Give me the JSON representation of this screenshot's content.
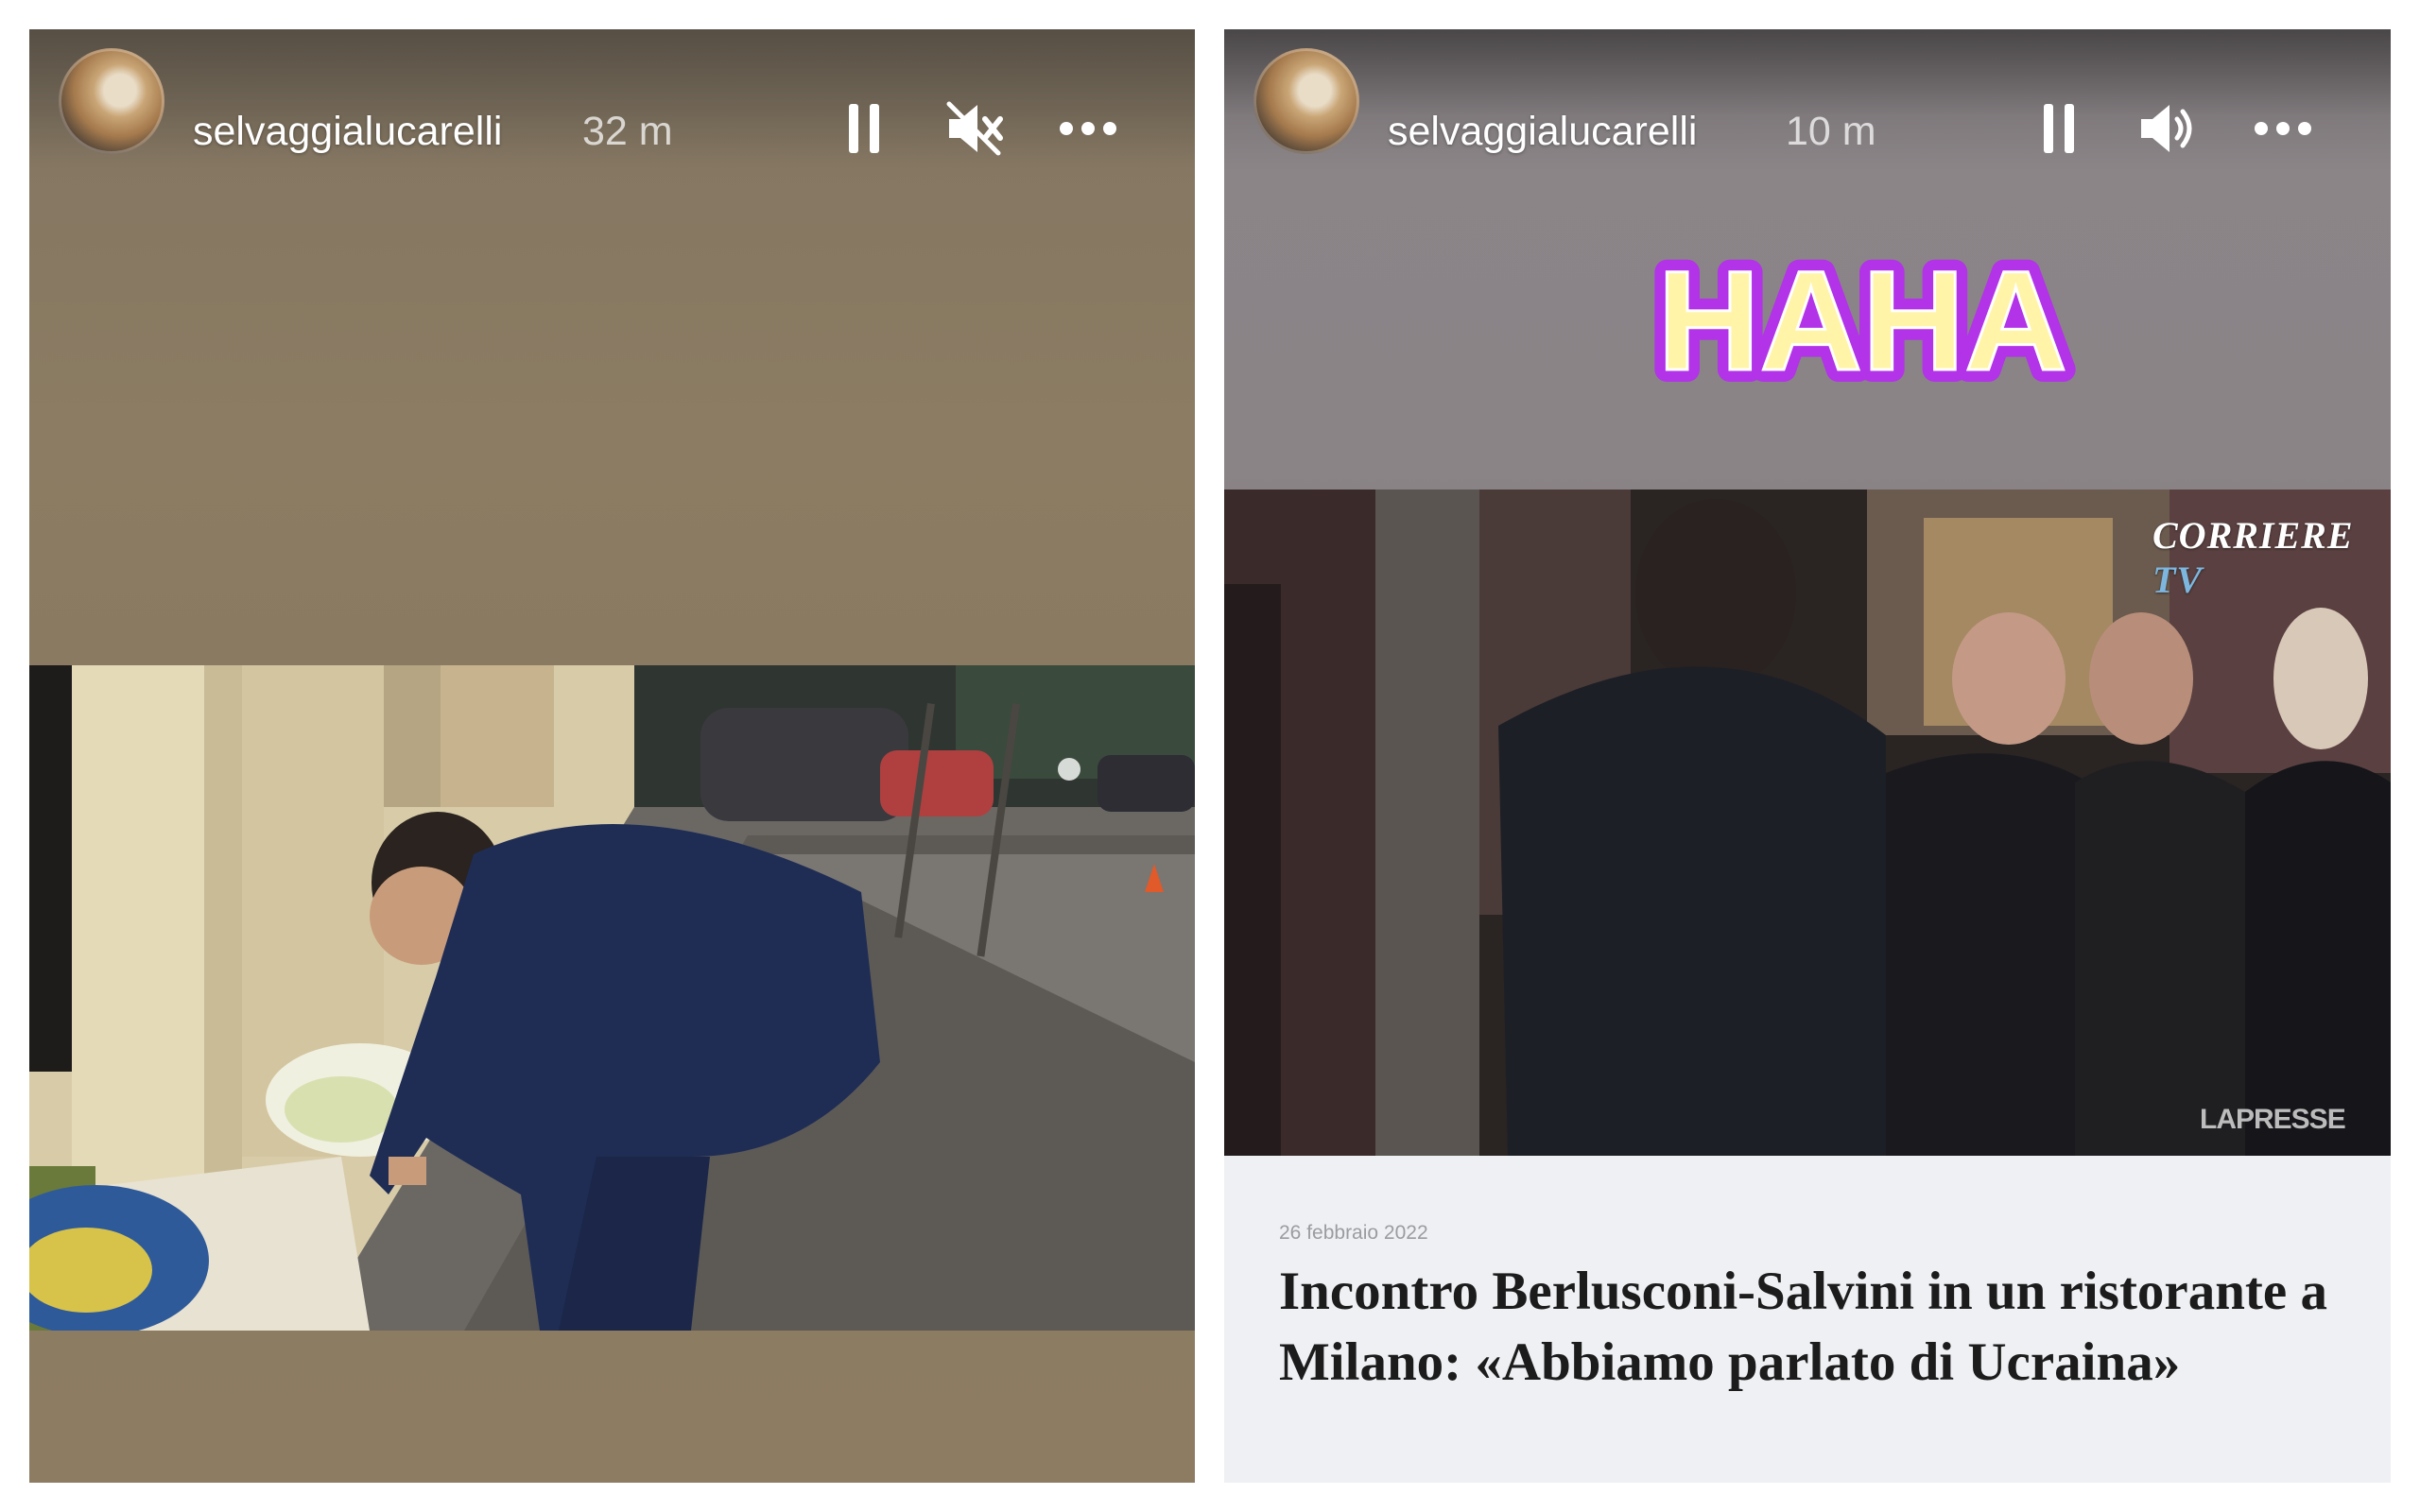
{
  "stories": [
    {
      "username": "selvaggialucarelli",
      "time": "32 m",
      "sound": "muted",
      "photo_description_icon": "photo-salvini-placing-flowers"
    },
    {
      "username": "selvaggialucarelli",
      "time": "10 m",
      "sound": "on",
      "sticker_text": "HAHA",
      "video_watermark": {
        "corriere": "CORRIERE",
        "tv": "TV",
        "agency": "LAPRESSE"
      },
      "article": {
        "date": "26 febbraio 2022",
        "title": "Incontro Berlusconi-Salvini in un ristorante a Milano: «Abbiamo parlato di Ucraina»"
      }
    }
  ],
  "colors": {
    "sticker_fill": "#fff4a8",
    "sticker_outline": "#b233e8",
    "header_text": "#ffffff"
  }
}
